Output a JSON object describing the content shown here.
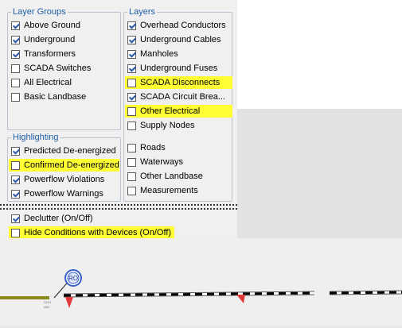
{
  "layer_groups": {
    "title": "Layer Groups",
    "items": [
      {
        "label": "Above Ground",
        "checked": true
      },
      {
        "label": "Underground",
        "checked": true
      },
      {
        "label": "Transformers",
        "checked": true
      },
      {
        "label": "SCADA Switches",
        "checked": false
      },
      {
        "label": "All Electrical",
        "checked": false
      },
      {
        "label": "Basic Landbase",
        "checked": false
      }
    ]
  },
  "layers": {
    "title": "Layers",
    "items": [
      {
        "label": "Overhead Conductors",
        "checked": true
      },
      {
        "label": "Underground Cables",
        "checked": true
      },
      {
        "label": "Manholes",
        "checked": true
      },
      {
        "label": "Underground Fuses",
        "checked": true
      },
      {
        "label": "SCADA Disconnects",
        "checked": false
      },
      {
        "label": "SCADA Circuit Brea...",
        "checked": true
      },
      {
        "label": "Other Electrical",
        "checked": false
      },
      {
        "label": "Supply Nodes",
        "checked": false
      },
      {
        "label": "Roads",
        "checked": false
      },
      {
        "label": "Waterways",
        "checked": false
      },
      {
        "label": "Other Landbase",
        "checked": false
      },
      {
        "label": "Measurements",
        "checked": false
      }
    ]
  },
  "highlighting": {
    "title": "Highlighting",
    "items": [
      {
        "label": "Predicted De-energized",
        "checked": true
      },
      {
        "label": "Confirmed De-energized",
        "checked": false
      },
      {
        "label": "Powerflow Violations",
        "checked": true
      },
      {
        "label": "Powerflow Warnings",
        "checked": true
      }
    ]
  },
  "options": {
    "items": [
      {
        "label": "Declutter (On/Off)",
        "checked": true
      },
      {
        "label": "Hide Conditions with Devices (On/Off)",
        "checked": false
      }
    ]
  },
  "map": {
    "badge_label": "RO",
    "small_labels": [
      "S203",
      "A6C"
    ]
  },
  "colors": {
    "highlight": "#ffff33",
    "group_title": "#1f5fa8",
    "checkmark": "#2a5aa5",
    "feeder_line": "#8b8a1e",
    "marker": "#e23a3a",
    "badge": "#3a5fc8"
  }
}
